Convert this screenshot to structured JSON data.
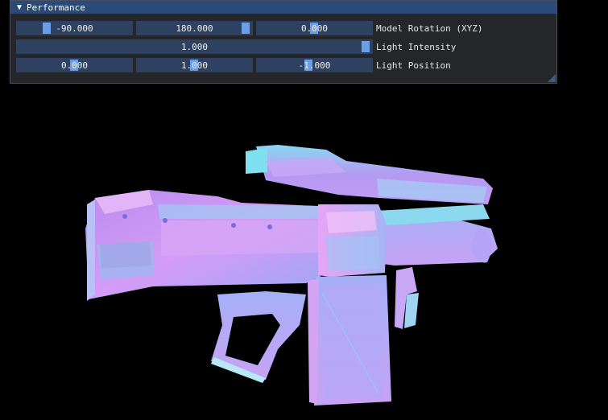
{
  "panel": {
    "title": "Performance",
    "collapse_icon": "triangle-down-icon",
    "rows": [
      {
        "label": "Model Rotation (XYZ)",
        "sliders": [
          {
            "value": "-90.000",
            "fill": 0.25
          },
          {
            "value": "180.000",
            "fill": 1.0
          },
          {
            "value": "0.000",
            "fill": 0.5
          }
        ]
      },
      {
        "label": "Light Intensity",
        "sliders": [
          {
            "value": "1.000",
            "fill": 1.0
          }
        ]
      },
      {
        "label": "Light Position",
        "sliders": [
          {
            "value": "0.000",
            "fill": 0.5
          },
          {
            "value": "1.000",
            "fill": 0.5
          },
          {
            "value": "-1.000",
            "fill": 0.42
          }
        ]
      }
    ]
  },
  "viewport": {
    "model": "gun-model-normal-shaded",
    "background": "#000000"
  },
  "colors": {
    "title_bg": "#2c4a78",
    "slider_bg": "#2e4160",
    "slider_grab": "#6a9ee8",
    "panel_bg": "#26282c"
  }
}
